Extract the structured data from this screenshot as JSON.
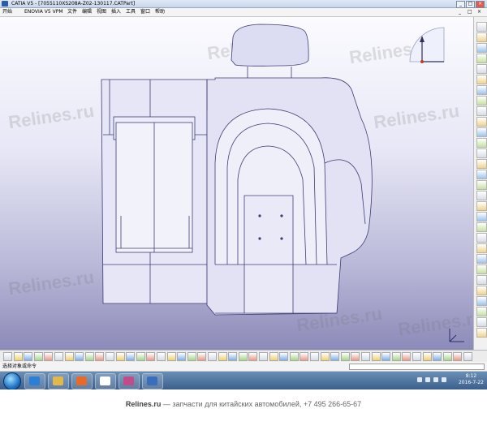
{
  "window": {
    "title": "CATIA V5 - [7055110XS208A-Z02-130117.CATPart]",
    "controls": [
      "_",
      "□",
      "×"
    ]
  },
  "menubar": {
    "items": [
      "开始",
      "ENOVIA V5 VPM",
      "文件",
      "编辑",
      "视图",
      "插入",
      "工具",
      "窗口",
      "帮助"
    ],
    "window_controls": [
      "_",
      "□",
      "×"
    ]
  },
  "viewport": {
    "watermark": "Relines.ru",
    "compass_icon": "compass-icon",
    "axis_icon": "axis-triad-icon",
    "model": "seat-back-3d-model"
  },
  "right_toolbar": {
    "icons": [
      "select-icon",
      "sketch-icon",
      "pad-icon",
      "pocket-icon",
      "shaft-icon",
      "groove-icon",
      "hole-icon",
      "rib-icon",
      "slot-icon",
      "stiffener-icon",
      "loft-icon",
      "fillet-icon",
      "chamfer-icon",
      "draft-icon",
      "shell-icon",
      "thickness-icon",
      "thread-icon",
      "split-icon",
      "thick-surface-icon",
      "close-surface-icon",
      "sew-icon",
      "translate-icon",
      "rotate-icon",
      "mirror-icon",
      "pattern-icon",
      "scale-icon",
      "assemble-icon",
      "constraint-icon",
      "measure-icon",
      "analysis-icon"
    ]
  },
  "bottom_toolbar": {
    "icons": [
      "new-icon",
      "open-icon",
      "save-icon",
      "print-icon",
      "cut-icon",
      "copy-icon",
      "paste-icon",
      "undo-icon",
      "redo-icon",
      "whats-this-icon",
      "3d-compass-icon",
      "zoom-icon",
      "fly-icon",
      "fit-all-icon",
      "pan-icon",
      "rotate-view-icon",
      "zoom-in-icon",
      "zoom-out-icon",
      "normal-view-icon",
      "iso-view-icon",
      "shading-icon",
      "hide-show-icon",
      "swap-space-icon",
      "point-icon",
      "line-icon",
      "plane-icon",
      "measure-icon",
      "material-icon",
      "catalog-icon",
      "knowledge-icon",
      "formula-icon",
      "parameter-icon",
      "law-icon",
      "update-icon",
      "sketcher-icon",
      "output-icon",
      "datum-icon",
      "boolean-icon",
      "analysis-icon",
      "power-copy-icon",
      "render-icon",
      "draft-icon",
      "publish-icon",
      "snap-icon",
      "grid-icon",
      "status-icon"
    ]
  },
  "statusbar": {
    "text": "选择对象或命令"
  },
  "taskbar": {
    "buttons": [
      "ie-icon",
      "explorer-icon",
      "media-player-icon",
      "catia-icon",
      "gallery-icon",
      "photo-icon"
    ],
    "clock_time": "8:12",
    "clock_date": "2016-7-22"
  },
  "footer": {
    "site": "Relines.ru",
    "tagline": " — запчасти для китайских автомобилей, +7 495 266-65-67"
  }
}
